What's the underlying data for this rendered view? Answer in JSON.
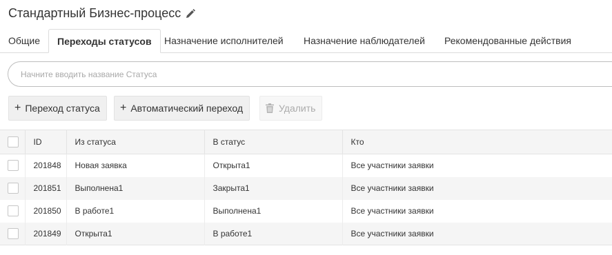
{
  "header": {
    "title": "Стандартный Бизнес-процесс",
    "edit_icon": "pencil-icon"
  },
  "tabs": [
    {
      "label": "Общие",
      "active": false
    },
    {
      "label": "Переходы статусов",
      "active": true
    },
    {
      "label": "Назначение исполнителей",
      "active": false
    },
    {
      "label": "Назначение наблюдателей",
      "active": false
    },
    {
      "label": "Рекомендованные действия",
      "active": false
    }
  ],
  "search": {
    "placeholder": "Начните вводить название Статуса",
    "value": ""
  },
  "toolbar": {
    "add_transition_label": "Переход статуса",
    "add_auto_transition_label": "Автоматический переход",
    "delete_label": "Удалить",
    "delete_disabled": true
  },
  "table": {
    "columns": [
      "ID",
      "Из статуса",
      "В статус",
      "Кто"
    ],
    "rows": [
      {
        "id": "201848",
        "from": "Новая заявка",
        "to": "Открыта1",
        "who": "Все участники заявки"
      },
      {
        "id": "201851",
        "from": "Выполнена1",
        "to": "Закрыта1",
        "who": "Все участники заявки"
      },
      {
        "id": "201850",
        "from": "В работе1",
        "to": "Выполнена1",
        "who": "Все участники заявки"
      },
      {
        "id": "201849",
        "from": "Открыта1",
        "to": "В работе1",
        "who": "Все участники заявки"
      }
    ]
  }
}
